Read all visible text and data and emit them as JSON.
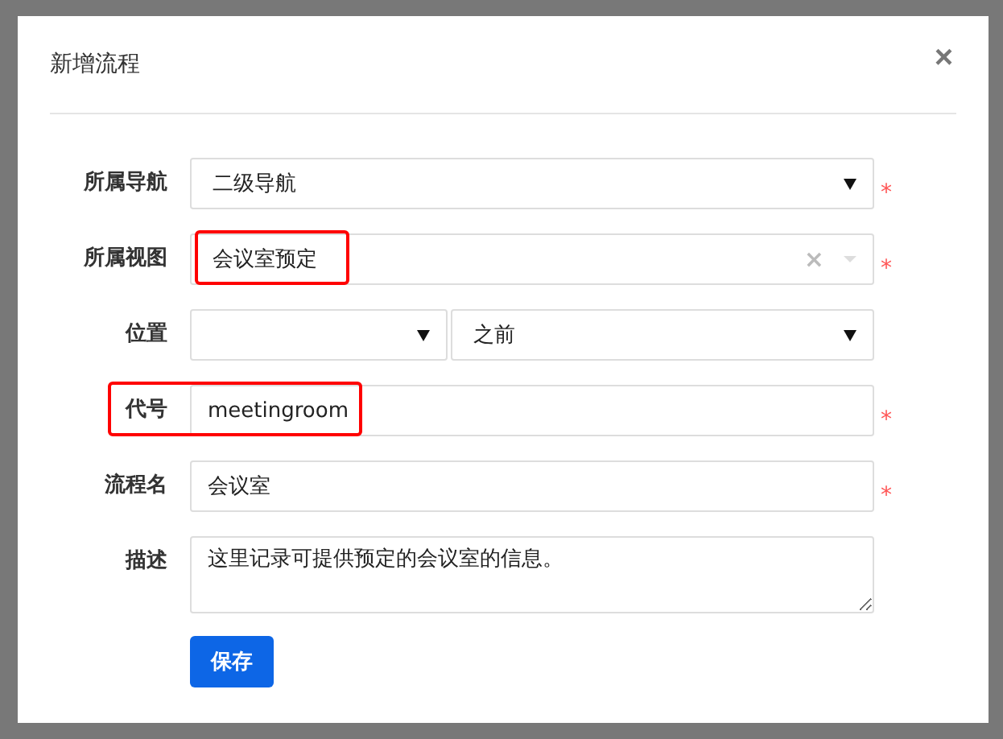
{
  "dialog": {
    "title": "新增流程",
    "close": "×"
  },
  "fields": [
    {
      "kind": "select",
      "label": "所属导航",
      "value": "二级导航",
      "required": true
    },
    {
      "kind": "combo",
      "label": "所属视图",
      "value": "会议室预定",
      "required": true,
      "value_highlighted": true,
      "clear": "×"
    },
    {
      "kind": "pair",
      "label": "位置",
      "second_value": "之前",
      "required": false
    },
    {
      "kind": "text",
      "label": "代号",
      "value": "meetingroom",
      "required": true,
      "value_highlighted": true,
      "label_highlighted": true
    },
    {
      "kind": "text",
      "label": "流程名",
      "value": "会议室",
      "required": true
    },
    {
      "kind": "textarea",
      "label": "描述",
      "value": "这里记录可提供预定的会议室的信息。",
      "required": false
    }
  ],
  "required_mark": "*",
  "save_button": "保存"
}
